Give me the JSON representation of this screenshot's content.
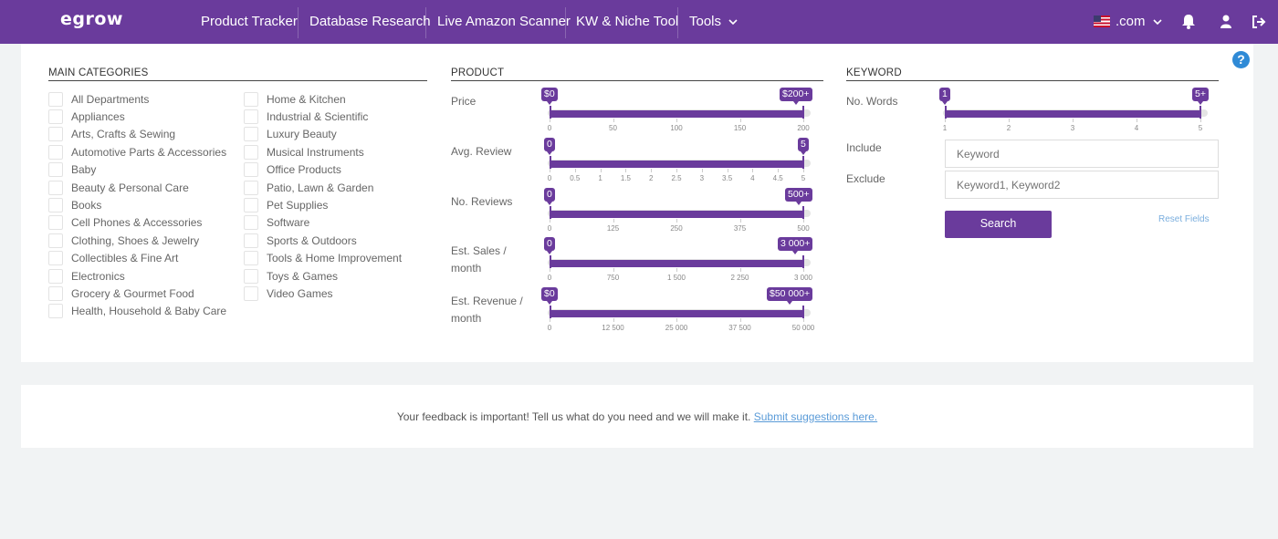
{
  "nav": {
    "logo": "egrow",
    "items": [
      "Product Tracker",
      "Database Research",
      "Live Amazon Scanner",
      "KW & Niche Tool",
      "Tools"
    ],
    "marketplace": ".com"
  },
  "categories": {
    "title": "MAIN CATEGORIES",
    "col1": [
      "All Departments",
      "Appliances",
      "Arts, Crafts & Sewing",
      "Automotive Parts & Accessories",
      "Baby",
      "Beauty & Personal Care",
      "Books",
      "Cell Phones & Accessories",
      "Clothing, Shoes & Jewelry",
      "Collectibles & Fine Art",
      "Electronics",
      "Grocery & Gourmet Food",
      "Health, Household & Baby Care"
    ],
    "col2": [
      "Home & Kitchen",
      "Industrial & Scientific",
      "Luxury Beauty",
      "Musical Instruments",
      "Office Products",
      "Patio, Lawn & Garden",
      "Pet Supplies",
      "Software",
      "Sports & Outdoors",
      "Tools & Home Improvement",
      "Toys & Games",
      "Video Games"
    ]
  },
  "product": {
    "title": "PRODUCT",
    "sliders": [
      {
        "label": "Price",
        "min_label": "$0",
        "max_label": "$200+",
        "ticks": [
          "0",
          "50",
          "100",
          "150",
          "200"
        ],
        "low": 0,
        "high": 1
      },
      {
        "label": "Avg. Review",
        "min_label": "0",
        "max_label": "5",
        "ticks": [
          "0",
          "0.5",
          "1",
          "1.5",
          "2",
          "2.5",
          "3",
          "3.5",
          "4",
          "4.5",
          "5"
        ],
        "low": 0,
        "high": 1
      },
      {
        "label": "No. Reviews",
        "min_label": "0",
        "max_label": "500+",
        "ticks": [
          "0",
          "125",
          "250",
          "375",
          "500"
        ],
        "low": 0,
        "high": 1
      },
      {
        "label": "Est. Sales / month",
        "min_label": "0",
        "max_label": "3 000+",
        "ticks": [
          "0",
          "750",
          "1 500",
          "2 250",
          "3 000"
        ],
        "low": 0,
        "high": 1
      },
      {
        "label": "Est. Revenue / month",
        "min_label": "$0",
        "max_label": "$50 000+",
        "ticks": [
          "0",
          "12 500",
          "25 000",
          "37 500",
          "50 000"
        ],
        "low": 0,
        "high": 1
      }
    ]
  },
  "keyword": {
    "title": "KEYWORD",
    "words": {
      "label": "No. Words",
      "min_label": "1",
      "max_label": "5+",
      "ticks": [
        "1",
        "2",
        "3",
        "4",
        "5"
      ],
      "low": 0,
      "high": 1
    },
    "include_label": "Include",
    "include_placeholder": "Keyword",
    "exclude_label": "Exclude",
    "exclude_placeholder": "Keyword1, Keyword2",
    "search_label": "Search",
    "reset_label": "Reset Fields"
  },
  "help_label": "?",
  "feedback": {
    "text": "Your feedback is important! Tell us what do you need and we will make it.",
    "link": "Submit suggestions here."
  }
}
